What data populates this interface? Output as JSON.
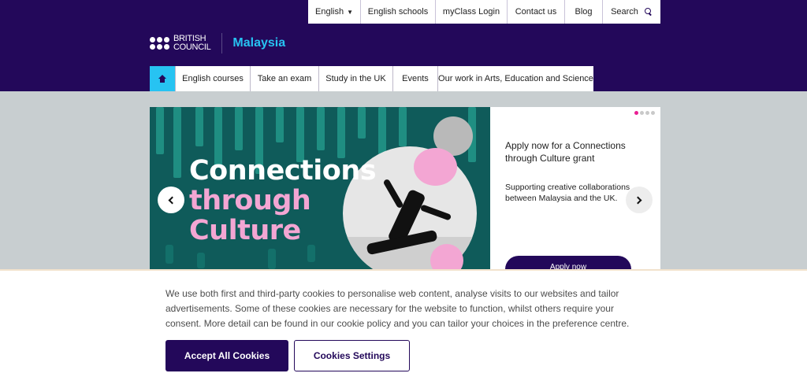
{
  "colors": {
    "brand_navy": "#23085a",
    "accent_cyan": "#27c3f2",
    "accent_pink": "#f3a6d3",
    "dot_active": "#e91e93"
  },
  "utility_nav": {
    "language": "English",
    "items": [
      "English schools",
      "myClass Login",
      "Contact us",
      "Blog"
    ],
    "search_label": "Search"
  },
  "logo": {
    "line1": "BRITISH",
    "line2": "COUNCIL",
    "country": "Malaysia"
  },
  "main_nav": {
    "home_icon": "home-icon",
    "items": [
      "English courses",
      "Take an exam",
      "Study in the UK",
      "Events",
      "Our work in Arts, Education and Science"
    ]
  },
  "hero": {
    "title_line1": "Connections",
    "title_line2": "through",
    "title_line3": "Culture",
    "card_title": "Apply now for a Connections through Culture grant",
    "card_description": "Supporting creative collaborations between Malaysia and the UK.",
    "cta_label": "Apply now",
    "prev_icon": "chevron-left-icon",
    "next_icon": "chevron-right-icon"
  },
  "cookie_banner": {
    "text": "We use both first and third-party cookies to personalise web content, analyse visits to our websites and tailor advertisements. Some of these cookies are necessary for the website to function, whilst others require your consent. More detail can be found in our cookie policy and you can tailor your choices in the preference centre.",
    "accept_label": "Accept All Cookies",
    "settings_label": "Cookies Settings"
  }
}
